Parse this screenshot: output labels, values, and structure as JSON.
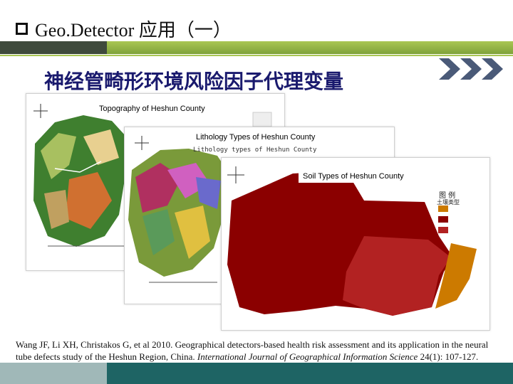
{
  "header": {
    "title": "Geo.Detector 应用（一）"
  },
  "subtitle": "神经管畸形环境风险因子代理变量",
  "maps": [
    {
      "label": "Topography of  Heshun County"
    },
    {
      "label": "Lithology Types of  Heshun County"
    },
    {
      "label": "Soil Types of  Heshun County"
    }
  ],
  "soil_legend": {
    "title": "图  例",
    "subtitle": "土壤类型"
  },
  "citation": {
    "authors": "Wang JF, Li XH, Christakos G, et al 2010. Geographical detectors-based health risk assessment and its application in the neural tube  defects study of the Heshun Region, China.",
    "journal": "International Journal of Geographical Information Science",
    "volume": "24(1): 107-127."
  },
  "colors": {
    "accent_green": "#a9c653",
    "footer_teal": "#1e6464",
    "subtitle_navy": "#1a1a6e",
    "soil_dark_red": "#8b0000",
    "soil_red": "#b22222",
    "soil_orange": "#cc7a00"
  }
}
